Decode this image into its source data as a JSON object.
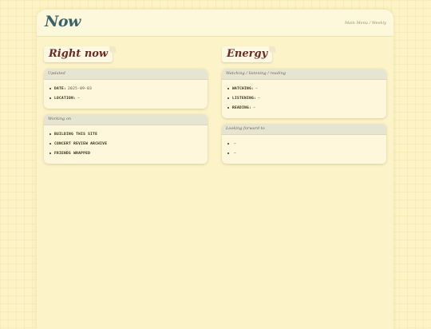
{
  "header": {
    "title": "Now",
    "nav": [
      "Main Menu",
      "Weekly"
    ],
    "nav_sep": "/"
  },
  "left": {
    "title": "Right now",
    "cards": [
      {
        "heading": "Updated",
        "items": [
          {
            "label": "Date:",
            "value": "2025-09-03"
          },
          {
            "label": "Location:",
            "value": "—"
          }
        ]
      },
      {
        "heading": "Working on",
        "items": [
          {
            "label": "Building this site",
            "value": ""
          },
          {
            "label": "Concert review archive",
            "value": ""
          },
          {
            "label": "Friends wrapped",
            "value": ""
          }
        ]
      }
    ]
  },
  "right": {
    "title": "Energy",
    "cards": [
      {
        "heading": "Watching / listening / reading",
        "items": [
          {
            "label": "Watching:",
            "value": "—"
          },
          {
            "label": "Listening:",
            "value": "—"
          },
          {
            "label": "Reading:",
            "value": "—"
          }
        ]
      },
      {
        "heading": "Looking forward to",
        "items": [
          {
            "label": "",
            "value": "—"
          },
          {
            "label": "",
            "value": "—"
          }
        ]
      }
    ]
  }
}
